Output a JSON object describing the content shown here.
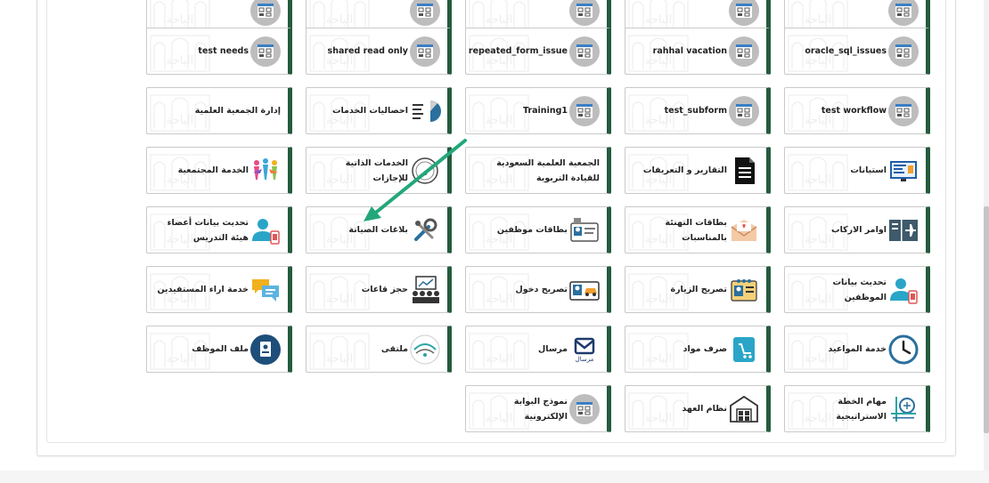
{
  "tiles": [
    {
      "name": "tile-top-1",
      "label": "",
      "icon": "gray-form-icon",
      "col": 0,
      "row": -1
    },
    {
      "name": "tile-top-2",
      "label": "",
      "icon": "gray-form-icon",
      "col": 1,
      "row": -1
    },
    {
      "name": "tile-top-3",
      "label": "",
      "icon": "gray-form-icon",
      "col": 2,
      "row": -1
    },
    {
      "name": "tile-top-4",
      "label": "",
      "icon": "gray-form-icon",
      "col": 3,
      "row": -1
    },
    {
      "name": "tile-top-5",
      "label": "",
      "icon": "gray-form-icon",
      "col": 4,
      "row": -1
    },
    {
      "name": "tile-oracle-sql-issues",
      "label": "oracle_sql_issues",
      "icon": "gray-form-icon",
      "col": 0,
      "row": 0,
      "ltr": true
    },
    {
      "name": "tile-rahhal-vacation",
      "label": "rahhal vacation",
      "icon": "gray-form-icon",
      "col": 1,
      "row": 0,
      "ltr": true
    },
    {
      "name": "tile-repeated-form-issue",
      "label": "repeated_form_issue",
      "icon": "gray-form-icon",
      "col": 2,
      "row": 0,
      "ltr": true
    },
    {
      "name": "tile-shared-read-only",
      "label": "shared read only",
      "icon": "gray-form-icon",
      "col": 3,
      "row": 0,
      "ltr": true
    },
    {
      "name": "tile-test-needs",
      "label": "test needs",
      "icon": "gray-form-icon",
      "col": 4,
      "row": 0,
      "ltr": true
    },
    {
      "name": "tile-test-workflow",
      "label": "test workflow",
      "icon": "gray-form-icon",
      "col": 0,
      "row": 1,
      "ltr": true
    },
    {
      "name": "tile-test-subform",
      "label": "test_subform",
      "icon": "gray-form-icon",
      "col": 1,
      "row": 1,
      "ltr": true
    },
    {
      "name": "tile-training1",
      "label": "Training1",
      "icon": "gray-form-icon",
      "col": 2,
      "row": 1,
      "ltr": true
    },
    {
      "name": "tile-services-stats",
      "label": "احصاليات الخدمات",
      "icon": "pie-chart-icon",
      "col": 3,
      "row": 1
    },
    {
      "name": "tile-scientific-association",
      "label": "إدارة الجمعية العلمية",
      "icon": "",
      "col": 4,
      "row": 1
    },
    {
      "name": "tile-surveys",
      "label": "استبانات",
      "icon": "monitor-survey-icon",
      "col": 0,
      "row": 2
    },
    {
      "name": "tile-reports-definitions",
      "label": "التقارير و التعريفات",
      "icon": "document-icon",
      "col": 1,
      "row": 2
    },
    {
      "name": "tile-saudi-association",
      "label": "الجمعية العلمية السعودية للقيادة التربوية",
      "icon": "",
      "col": 2,
      "row": 2
    },
    {
      "name": "tile-self-service-leave",
      "label": "الخدمات الذاتية للإجازات",
      "icon": "leave-badge-icon",
      "col": 3,
      "row": 2
    },
    {
      "name": "tile-community-service",
      "label": "الخدمة المجتمعية",
      "icon": "people-colorful-icon",
      "col": 4,
      "row": 2
    },
    {
      "name": "tile-boarding-orders",
      "label": "اوامر الاركاب",
      "icon": "airplane-ticket-icon",
      "col": 0,
      "row": 3
    },
    {
      "name": "tile-greeting-cards",
      "label": "بطاقات التهنئة بالمناسبات",
      "icon": "envelope-icon",
      "col": 1,
      "row": 3
    },
    {
      "name": "tile-employee-cards",
      "label": "بطاقات موظفين",
      "icon": "id-card-icon",
      "col": 2,
      "row": 3
    },
    {
      "name": "tile-maintenance-reports",
      "label": "بلاغات الصيانة",
      "icon": "tools-icon",
      "col": 3,
      "row": 3
    },
    {
      "name": "tile-faculty-data-update",
      "label": "تحديث بيانات أعضاء هيئة التدريس",
      "icon": "user-phone-icon",
      "col": 4,
      "row": 3
    },
    {
      "name": "tile-employee-data-update",
      "label": "تحديث بيانات الموظفين",
      "icon": "user-phone-icon",
      "col": 0,
      "row": 4
    },
    {
      "name": "tile-visit-permit",
      "label": "تصريح الزيارة",
      "icon": "permit-icon",
      "col": 1,
      "row": 4
    },
    {
      "name": "tile-entry-permit",
      "label": "تصريح دخول",
      "icon": "car-card-icon",
      "col": 2,
      "row": 4
    },
    {
      "name": "tile-hall-booking",
      "label": "حجز قاعات",
      "icon": "meeting-room-icon",
      "col": 3,
      "row": 4
    },
    {
      "name": "tile-beneficiary-opinion",
      "label": "خدمة اراء المستفيدين",
      "icon": "chat-bubbles-icon",
      "col": 4,
      "row": 4
    },
    {
      "name": "tile-appointments",
      "label": "خدمة المواعيد",
      "icon": "clock-icon",
      "col": 0,
      "row": 5
    },
    {
      "name": "tile-materials-disbursement",
      "label": "صرف مواد",
      "icon": "cart-icon",
      "col": 1,
      "row": 5
    },
    {
      "name": "tile-mursal",
      "label": "مرسال",
      "icon": "mursal-logo-icon",
      "col": 2,
      "row": 5
    },
    {
      "name": "tile-multaqa",
      "label": "ملتقى",
      "icon": "multaqa-logo-icon",
      "col": 3,
      "row": 5
    },
    {
      "name": "tile-employee-file",
      "label": "ملف الموظف",
      "icon": "employee-file-icon",
      "col": 4,
      "row": 5
    },
    {
      "name": "tile-strategic-plan-tasks",
      "label": "مهام الخطة الاستراتيجية",
      "icon": "strategy-icon",
      "col": 0,
      "row": 6
    },
    {
      "name": "tile-custody-system",
      "label": "نظام العهد",
      "icon": "warehouse-icon",
      "col": 1,
      "row": 6
    },
    {
      "name": "tile-portal-form",
      "label": "نموذج البوابة الإلكترونية",
      "icon": "gray-form-icon",
      "col": 2,
      "row": 6
    }
  ],
  "colors": {
    "tile_accent": "#245b3e",
    "arrow": "#23a77a",
    "icon_gray": "#bdbdbd",
    "icon_blue": "#2a6f9e"
  }
}
